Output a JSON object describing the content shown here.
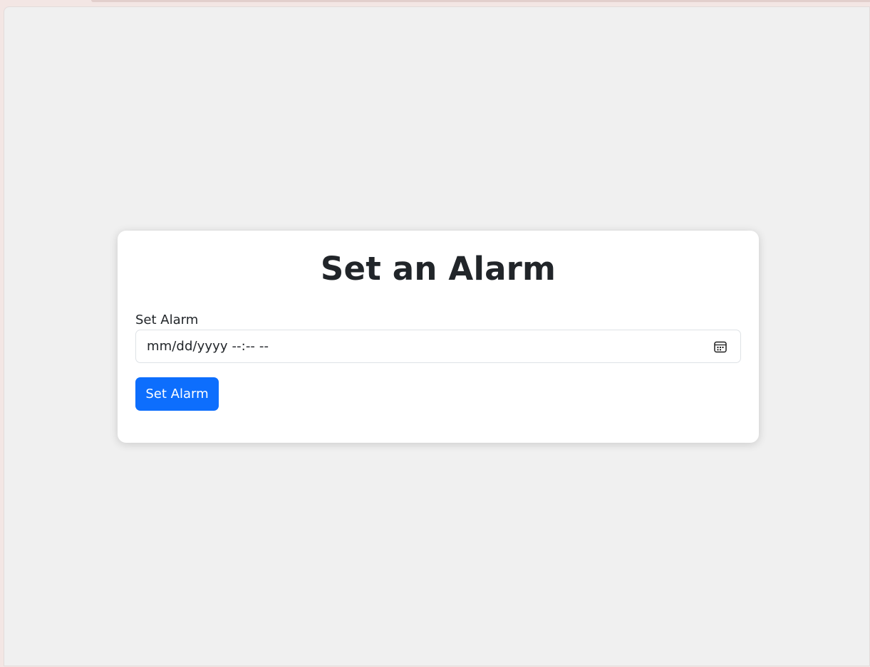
{
  "card": {
    "title": "Set an Alarm",
    "field_label": "Set Alarm",
    "datetime_placeholder": "mm/dd/yyyy --:-- --",
    "submit_label": "Set Alarm"
  },
  "colors": {
    "accent": "#0d6efd",
    "page_background": "#f0f0f0",
    "card_background": "#ffffff",
    "text": "#212529"
  },
  "icons": {
    "datetime_picker": "calendar-icon"
  }
}
